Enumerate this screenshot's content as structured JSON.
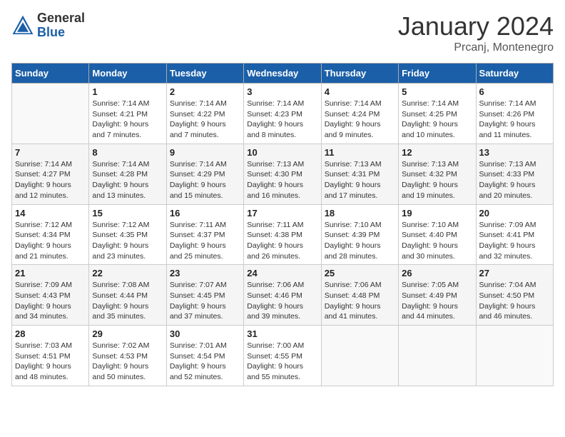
{
  "header": {
    "logo_general": "General",
    "logo_blue": "Blue",
    "month_title": "January 2024",
    "subtitle": "Prcanj, Montenegro"
  },
  "days_of_week": [
    "Sunday",
    "Monday",
    "Tuesday",
    "Wednesday",
    "Thursday",
    "Friday",
    "Saturday"
  ],
  "weeks": [
    [
      {
        "day": "",
        "info": ""
      },
      {
        "day": "1",
        "info": "Sunrise: 7:14 AM\nSunset: 4:21 PM\nDaylight: 9 hours\nand 7 minutes."
      },
      {
        "day": "2",
        "info": "Sunrise: 7:14 AM\nSunset: 4:22 PM\nDaylight: 9 hours\nand 7 minutes."
      },
      {
        "day": "3",
        "info": "Sunrise: 7:14 AM\nSunset: 4:23 PM\nDaylight: 9 hours\nand 8 minutes."
      },
      {
        "day": "4",
        "info": "Sunrise: 7:14 AM\nSunset: 4:24 PM\nDaylight: 9 hours\nand 9 minutes."
      },
      {
        "day": "5",
        "info": "Sunrise: 7:14 AM\nSunset: 4:25 PM\nDaylight: 9 hours\nand 10 minutes."
      },
      {
        "day": "6",
        "info": "Sunrise: 7:14 AM\nSunset: 4:26 PM\nDaylight: 9 hours\nand 11 minutes."
      }
    ],
    [
      {
        "day": "7",
        "info": "Sunrise: 7:14 AM\nSunset: 4:27 PM\nDaylight: 9 hours\nand 12 minutes."
      },
      {
        "day": "8",
        "info": "Sunrise: 7:14 AM\nSunset: 4:28 PM\nDaylight: 9 hours\nand 13 minutes."
      },
      {
        "day": "9",
        "info": "Sunrise: 7:14 AM\nSunset: 4:29 PM\nDaylight: 9 hours\nand 15 minutes."
      },
      {
        "day": "10",
        "info": "Sunrise: 7:13 AM\nSunset: 4:30 PM\nDaylight: 9 hours\nand 16 minutes."
      },
      {
        "day": "11",
        "info": "Sunrise: 7:13 AM\nSunset: 4:31 PM\nDaylight: 9 hours\nand 17 minutes."
      },
      {
        "day": "12",
        "info": "Sunrise: 7:13 AM\nSunset: 4:32 PM\nDaylight: 9 hours\nand 19 minutes."
      },
      {
        "day": "13",
        "info": "Sunrise: 7:13 AM\nSunset: 4:33 PM\nDaylight: 9 hours\nand 20 minutes."
      }
    ],
    [
      {
        "day": "14",
        "info": "Sunrise: 7:12 AM\nSunset: 4:34 PM\nDaylight: 9 hours\nand 21 minutes."
      },
      {
        "day": "15",
        "info": "Sunrise: 7:12 AM\nSunset: 4:35 PM\nDaylight: 9 hours\nand 23 minutes."
      },
      {
        "day": "16",
        "info": "Sunrise: 7:11 AM\nSunset: 4:37 PM\nDaylight: 9 hours\nand 25 minutes."
      },
      {
        "day": "17",
        "info": "Sunrise: 7:11 AM\nSunset: 4:38 PM\nDaylight: 9 hours\nand 26 minutes."
      },
      {
        "day": "18",
        "info": "Sunrise: 7:10 AM\nSunset: 4:39 PM\nDaylight: 9 hours\nand 28 minutes."
      },
      {
        "day": "19",
        "info": "Sunrise: 7:10 AM\nSunset: 4:40 PM\nDaylight: 9 hours\nand 30 minutes."
      },
      {
        "day": "20",
        "info": "Sunrise: 7:09 AM\nSunset: 4:41 PM\nDaylight: 9 hours\nand 32 minutes."
      }
    ],
    [
      {
        "day": "21",
        "info": "Sunrise: 7:09 AM\nSunset: 4:43 PM\nDaylight: 9 hours\nand 34 minutes."
      },
      {
        "day": "22",
        "info": "Sunrise: 7:08 AM\nSunset: 4:44 PM\nDaylight: 9 hours\nand 35 minutes."
      },
      {
        "day": "23",
        "info": "Sunrise: 7:07 AM\nSunset: 4:45 PM\nDaylight: 9 hours\nand 37 minutes."
      },
      {
        "day": "24",
        "info": "Sunrise: 7:06 AM\nSunset: 4:46 PM\nDaylight: 9 hours\nand 39 minutes."
      },
      {
        "day": "25",
        "info": "Sunrise: 7:06 AM\nSunset: 4:48 PM\nDaylight: 9 hours\nand 41 minutes."
      },
      {
        "day": "26",
        "info": "Sunrise: 7:05 AM\nSunset: 4:49 PM\nDaylight: 9 hours\nand 44 minutes."
      },
      {
        "day": "27",
        "info": "Sunrise: 7:04 AM\nSunset: 4:50 PM\nDaylight: 9 hours\nand 46 minutes."
      }
    ],
    [
      {
        "day": "28",
        "info": "Sunrise: 7:03 AM\nSunset: 4:51 PM\nDaylight: 9 hours\nand 48 minutes."
      },
      {
        "day": "29",
        "info": "Sunrise: 7:02 AM\nSunset: 4:53 PM\nDaylight: 9 hours\nand 50 minutes."
      },
      {
        "day": "30",
        "info": "Sunrise: 7:01 AM\nSunset: 4:54 PM\nDaylight: 9 hours\nand 52 minutes."
      },
      {
        "day": "31",
        "info": "Sunrise: 7:00 AM\nSunset: 4:55 PM\nDaylight: 9 hours\nand 55 minutes."
      },
      {
        "day": "",
        "info": ""
      },
      {
        "day": "",
        "info": ""
      },
      {
        "day": "",
        "info": ""
      }
    ]
  ]
}
